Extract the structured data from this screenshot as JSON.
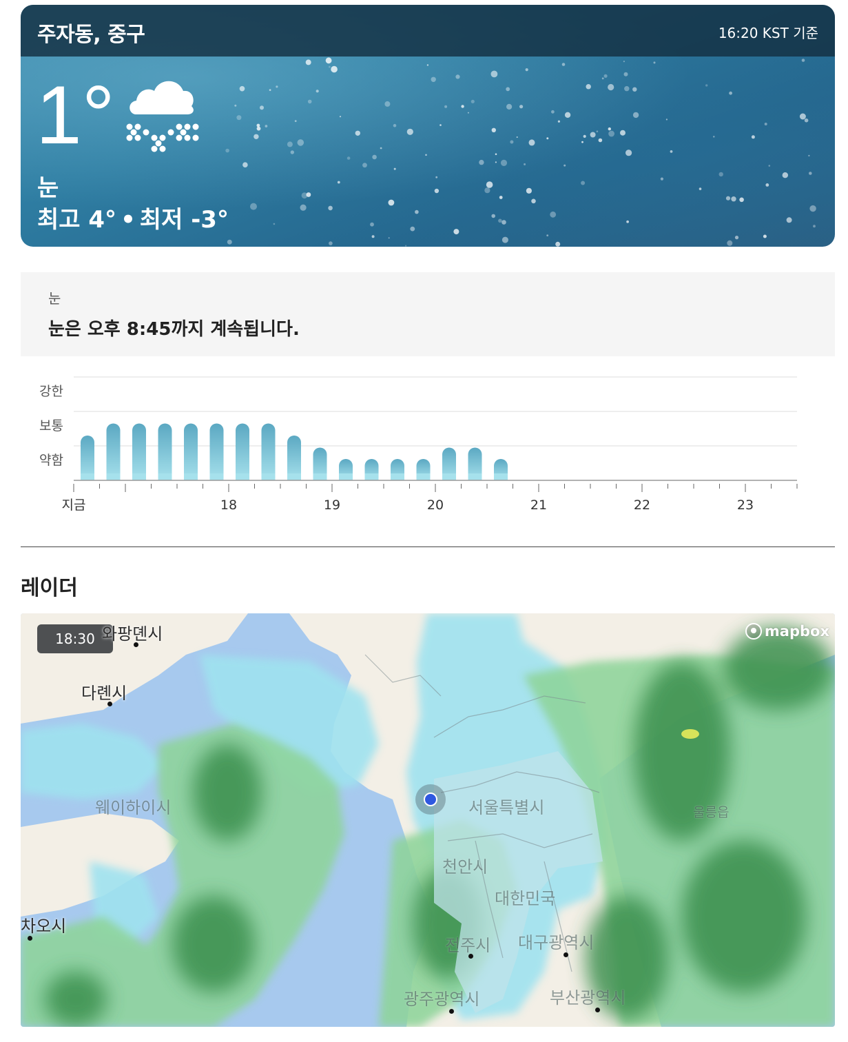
{
  "header": {
    "location": "주자동, 중구",
    "as_of": "16:20 KST 기준"
  },
  "current": {
    "temperature": "1°",
    "condition": "눈",
    "condition_icon": "snow-cloud-icon",
    "high_label": "최고 4°",
    "separator": "•",
    "low_label": "최저 -3°"
  },
  "precipitation": {
    "type_label": "눈",
    "summary": "눈은 오후 8:45까지 계속됩니다."
  },
  "chart_data": {
    "type": "bar",
    "y_levels": [
      "약함",
      "보통",
      "강한"
    ],
    "x_tick_labels": [
      "지금",
      "18",
      "19",
      "20",
      "21",
      "22",
      "23"
    ],
    "interval_minutes": 15,
    "values": [
      1.3,
      1.65,
      1.65,
      1.65,
      1.65,
      1.65,
      1.65,
      1.65,
      1.3,
      0.95,
      0.62,
      0.62,
      0.62,
      0.62,
      0.95,
      0.95,
      0.62
    ],
    "ylim": [
      0,
      3
    ],
    "bar_color": "#5ba8c2",
    "grid": true
  },
  "radar": {
    "title": "레이더",
    "time": "18:30",
    "attribution": "mapbox",
    "places": {
      "wafangdian": "와팡뎬시",
      "dalian": "다롄시",
      "weihai": "웨이하이시",
      "yantai": "차오시",
      "seoul": "서울특별시",
      "cheonan": "천안시",
      "korea": "대한민국",
      "jeonju": "전주시",
      "daegu": "대구광역시",
      "gwangju": "광주광역시",
      "busan": "부산광역시",
      "ulleung": "울릉읍"
    },
    "colors": {
      "sea": "#a7c9ee",
      "land": "#f3efe6",
      "snow": "#9fe2ef",
      "rain_light": "#8ed49a",
      "rain_heavy": "#3a8f4e"
    }
  }
}
